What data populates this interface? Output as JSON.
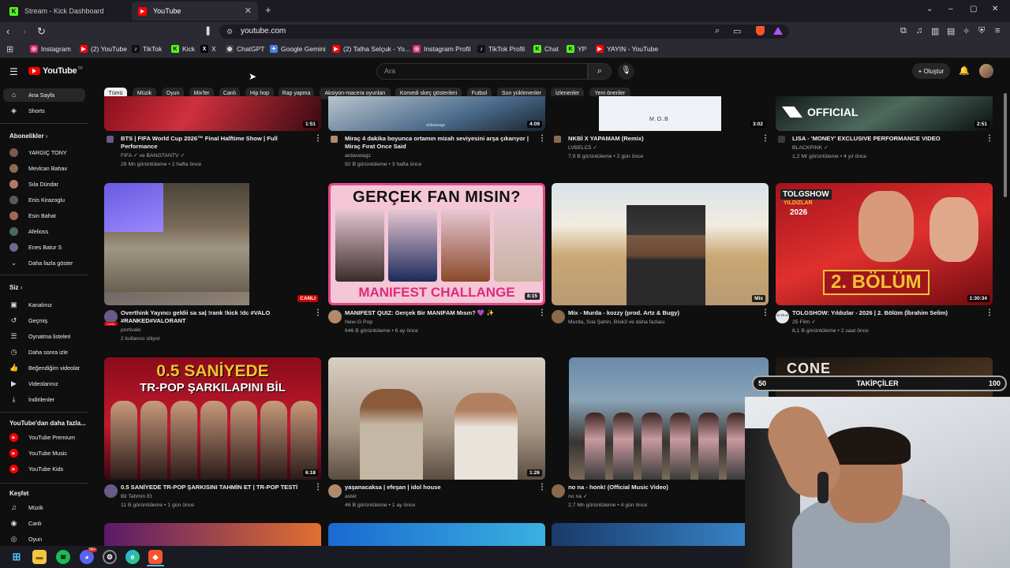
{
  "browser": {
    "tabs": [
      {
        "title": "Stream - Kick Dashboard",
        "icon": "kick-icon",
        "color": "#53fc18"
      },
      {
        "title": "YouTube",
        "icon": "youtube-icon",
        "color": "#ff0000"
      }
    ],
    "new_tab": "+",
    "url": "youtube.com",
    "bookmarks": [
      {
        "label": "Instagram",
        "color": "#d62976",
        "glyph": "◎"
      },
      {
        "label": "(2) YouTube",
        "color": "#ff0000",
        "glyph": "▶"
      },
      {
        "label": "TikTok",
        "color": "#111111",
        "glyph": "♪"
      },
      {
        "label": "Kick",
        "color": "#53fc18",
        "glyph": "K"
      },
      {
        "label": "X",
        "color": "#000000",
        "glyph": "X"
      },
      {
        "label": "ChatGPT",
        "color": "#444444",
        "glyph": "◍"
      },
      {
        "label": "Google Gemini",
        "color": "#4a7fe0",
        "glyph": "✦"
      },
      {
        "label": "(2) Talha Selçuk - Yo...",
        "color": "#ff0000",
        "glyph": "▶"
      },
      {
        "label": "Instagram Profil",
        "color": "#d62976",
        "glyph": "◎"
      },
      {
        "label": "TikTok Profil",
        "color": "#111111",
        "glyph": "♪"
      },
      {
        "label": "Chat",
        "color": "#53fc18",
        "glyph": "K"
      },
      {
        "label": "YP",
        "color": "#53fc18",
        "glyph": "K"
      },
      {
        "label": "YAYIN - YouTube",
        "color": "#ff0000",
        "glyph": "▶"
      }
    ]
  },
  "youtube": {
    "logo": "YouTube",
    "logo_sup": "TR",
    "search_placeholder": "Ara",
    "create_label": "+ Oluştur",
    "sidebar": {
      "home": "Ana Sayfa",
      "shorts": "Shorts",
      "subs_header": "Abonelikler",
      "subs": [
        {
          "label": "YARGIÇ TONY",
          "color": "#7a5a4a"
        },
        {
          "label": "Mevlcan Bahav",
          "color": "#8a6a52"
        },
        {
          "label": "Sıla Dündar",
          "color": "#b07a6a"
        },
        {
          "label": "Enis Kirazoglu",
          "color": "#5a5a5a"
        },
        {
          "label": "Esin Bahat",
          "color": "#9a6a5a"
        },
        {
          "label": "Afelioss",
          "color": "#4a6a5a"
        },
        {
          "label": "Enes Batur S",
          "color": "#6a6a8a"
        }
      ],
      "more": "Daha fazla göster",
      "you_header": "Siz",
      "you": [
        "Kanalınız",
        "Geçmiş",
        "Oynatma listeleri",
        "Daha sonra izle",
        "Beğendiğim videolar",
        "Videolarınız",
        "İndirilenler"
      ],
      "more_header": "YouTube'dan daha fazla...",
      "more_items": [
        "YouTube Premium",
        "YouTube Music",
        "YouTube Kids"
      ],
      "explore_header": "Keşfet",
      "explore": [
        "Müzik",
        "Canlı",
        "Oyun"
      ]
    },
    "chips": [
      "Tümü",
      "Müzik",
      "Oyun",
      "Mix'ler",
      "Canlı",
      "Hip hop",
      "Rap yapma",
      "Aksiyon-macera oyunları",
      "Komedi skeç gösterileri",
      "Futbol",
      "Son yüklenenler",
      "İzlenenler",
      "Yeni öneriler"
    ],
    "videos_row1": [
      {
        "title": "BTS | FIFA World Cup 2026™ Final Halftime Show | Full Performance",
        "channel": "FIFA ✓ ve BANGTANTV ✓",
        "meta": "28 Mn görüntüleme • 2 hafta önce",
        "duration": "1:51"
      },
      {
        "title": "Miraç 4 dakika boyunca ortamın mizah seviyesini arşa çıkarıyor | Miraç Fırat Once Said",
        "channel": "ardaswagz",
        "meta": "92 B görüntüleme • 3 hafta önce",
        "duration": "4:09",
        "thumb_text": "ardaswagz"
      },
      {
        "title": "NKBİ X YAPAMAM (Remix)",
        "channel": "LVBELC5 ✓",
        "meta": "7,9 B görüntüleme • 2 gün önce",
        "duration": "3:02",
        "thumb_text": "M.O.B"
      },
      {
        "title": "LISA - 'MONEY' EXCLUSIVE PERFORMANCE VIDEO",
        "channel": "BLACKPINK ✓",
        "meta": "1,2 Mr görüntüleme • 4 yıl önce",
        "duration": "2:51",
        "thumb_text": "OFFICIAL"
      }
    ],
    "videos_row2": [
      {
        "title": "Overthink Yayıncı geldii  sa sa| !rank !kick !dc #VALO #RANKED#VALORANT",
        "channel": "portivalo",
        "meta": "2 kullanıcı izliyor",
        "duration": "CANLI",
        "avatar_badge": "CANLI"
      },
      {
        "title": "MANIFEST QUIZ: Gerçek Bir MANIFAM Mısın? 💜 ✨",
        "channel": "New-G Pop",
        "meta": "646 B görüntüleme • 6 ay önce",
        "duration": "8:15",
        "thumb_top": "GERÇEK FAN MISIN?",
        "thumb_bottom": "MANIFEST CHALLANGE"
      },
      {
        "title": "Mix - Murda - kozzy (prod. Artz & Bugy)",
        "channel": "Murda, Sıla Şahin, Blok3 ve daha fazlası",
        "meta": "",
        "duration": "Mix"
      },
      {
        "title": "TOLGSHOW: Yıldızlar - 2026 | 2. Bölüm (İbrahim Selim)",
        "channel": "25 Film ✓",
        "meta": "6,1 B görüntüleme • 2 saat önce",
        "duration": "1:30:34",
        "thumb_top": "TOLGSHOW",
        "thumb_sub": "YILDIZLAR",
        "thumb_year": "2026",
        "thumb_bottom": "2. BÖLÜM",
        "avatar_text": "25 FİLM"
      }
    ],
    "videos_row3": [
      {
        "title": "0.5 SANİYEDE TR-POP ŞARKISINI TAHMİN ET | TR-POP TESTİ",
        "channel": "Bil Tahmin Et",
        "meta": "11 B görüntüleme • 1 gün önce",
        "duration": "6:18",
        "thumb_top": "0.5 SANİYEDE",
        "thumb_sub": "TR-POP ŞARKILAPINI BİL"
      },
      {
        "title": "yaşanacaksa | efeşan | idol house",
        "channel": "astér",
        "meta": "46 B görüntüleme • 1 ay önce",
        "duration": "1:26"
      },
      {
        "title": "no na - honk! (Official Music Video)",
        "channel": "no na ✓",
        "meta": "2,7 Mn görüntüleme • 4 gün önce",
        "duration": ""
      },
      {
        "title": "",
        "channel": "",
        "meta": "",
        "duration": "",
        "thumb_text": "CONE"
      }
    ]
  },
  "overlay": {
    "follow_min": "50",
    "follow_label": "TAKİPÇİLER",
    "follow_max": "100"
  },
  "taskbar": {
    "badge": "99+"
  }
}
